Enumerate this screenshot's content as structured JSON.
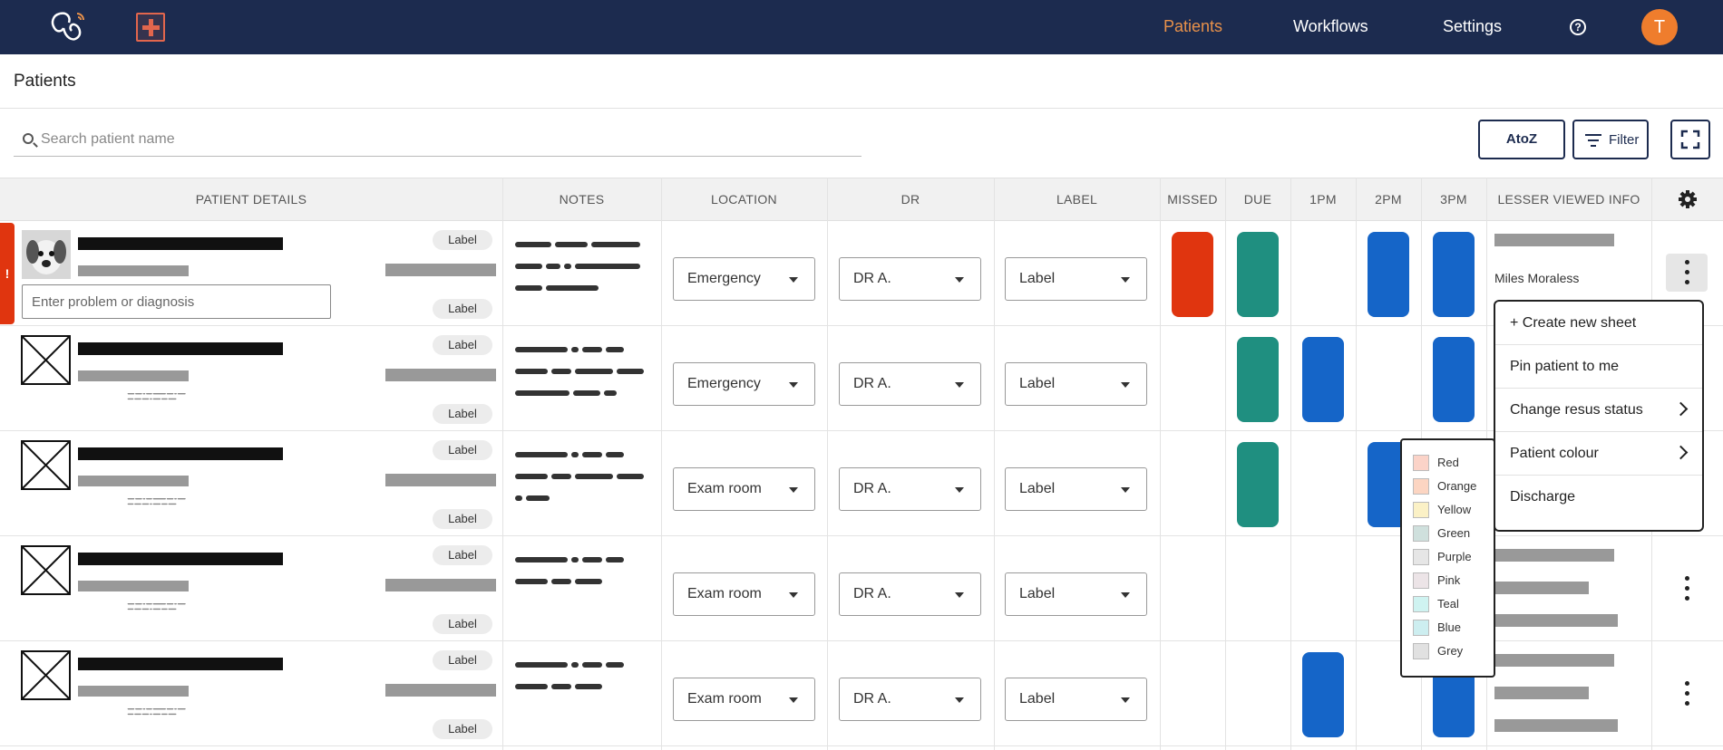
{
  "nav": {
    "links": [
      "Patients",
      "Workflows",
      "Settings"
    ],
    "help_glyph": "?",
    "avatar_initial": "T",
    "icons": [
      "stethoscope-logo-icon",
      "medical-cross-icon",
      "help-circle-icon"
    ]
  },
  "page": {
    "title": "Patients"
  },
  "search": {
    "placeholder": "Search patient name"
  },
  "toolbar": {
    "sort_label": "AtoZ",
    "filter_label": "Filter"
  },
  "columns": [
    "PATIENT DETAILS",
    "NOTES",
    "LOCATION",
    "DR",
    "LABEL",
    "MISSED",
    "DUE",
    "1PM",
    "2PM",
    "3PM",
    "LESSER VIEWED INFO"
  ],
  "patient_details": {
    "label_text": "Label",
    "diagnosis_placeholder": "Enter problem or diagnosis",
    "alert_glyph": "!"
  },
  "rows": [
    {
      "location": "Emergency",
      "doctor": "DR A.",
      "label": "Label",
      "info_name": "Miles Moraless",
      "missed": "red",
      "due": "teal",
      "p1": "",
      "p2": "blue",
      "p3": "blue"
    },
    {
      "location": "Emergency",
      "doctor": "DR A.",
      "label": "Label",
      "missed": "",
      "due": "teal",
      "p1": "blue",
      "p2": "",
      "p3": "blue"
    },
    {
      "location": "Exam room",
      "doctor": "DR A.",
      "label": "Label",
      "missed": "",
      "due": "teal",
      "p1": "",
      "p2": "blue",
      "p3": ""
    },
    {
      "location": "Exam room",
      "doctor": "DR A.",
      "label": "Label",
      "missed": "",
      "due": "",
      "p1": "",
      "p2": "",
      "p3": ""
    },
    {
      "location": "Exam room",
      "doctor": "DR A.",
      "label": "Label",
      "missed": "",
      "due": "",
      "p1": "blue",
      "p2": "",
      "p3": "blue"
    }
  ],
  "context_menu": {
    "items": [
      "+ Create new sheet",
      "Pin patient to me",
      "Change resus status",
      "Patient colour",
      "Discharge"
    ]
  },
  "colour_menu": {
    "items": [
      {
        "name": "Red",
        "color": "#fbd3c8"
      },
      {
        "name": "Orange",
        "color": "#fcd5c2"
      },
      {
        "name": "Yellow",
        "color": "#fbf1c6"
      },
      {
        "name": "Green",
        "color": "#cfe0dd"
      },
      {
        "name": "Purple",
        "color": "#e6e6e6"
      },
      {
        "name": "Pink",
        "color": "#ece4e7"
      },
      {
        "name": "Teal",
        "color": "#cff3f1"
      },
      {
        "name": "Blue",
        "color": "#cdeef0"
      },
      {
        "name": "Grey",
        "color": "#e1e1e1"
      }
    ]
  },
  "colors": {
    "navy": "#1c2b4f",
    "accent": "#e8914a",
    "alert_red": "#e0350f",
    "teal": "#1f8f80",
    "blue": "#1565c8"
  }
}
